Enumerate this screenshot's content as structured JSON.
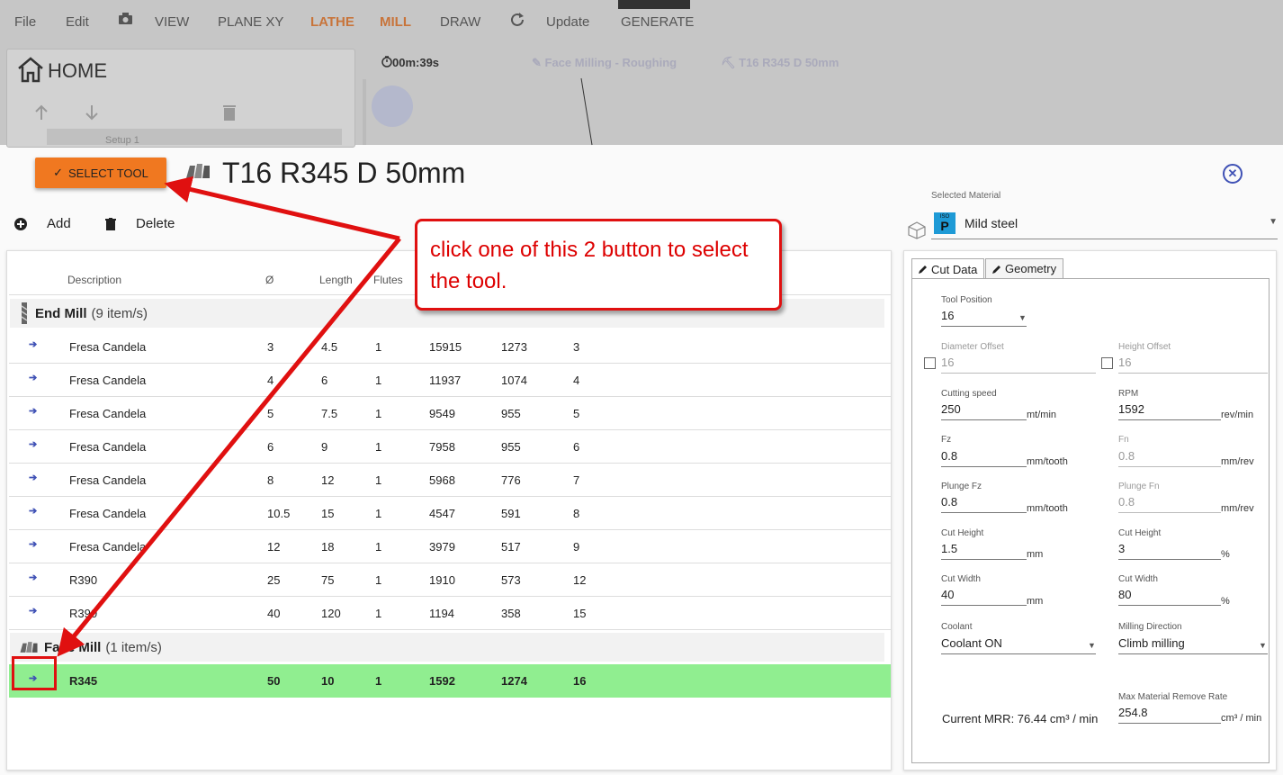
{
  "menubar": {
    "file": "File",
    "edit": "Edit",
    "view": "VIEW",
    "plane": "PLANE XY",
    "lathe": "LATHE",
    "mill": "MILL",
    "draw": "DRAW",
    "update": "Update",
    "generate": "GENERATE"
  },
  "background": {
    "home_title": "HOME",
    "setup_label": "Setup 1",
    "timer": "00m:39s",
    "operation": "Face Milling - Roughing",
    "tool_ref": "T16 R345 D 50mm"
  },
  "header": {
    "select_tool_label": "SELECT TOOL",
    "tool_title": "T16 R345 D 50mm",
    "add_label": "Add",
    "delete_label": "Delete"
  },
  "material": {
    "label": "Selected Material",
    "iso_top": "ISO",
    "iso_letter": "P",
    "name": "Mild steel"
  },
  "callout": {
    "text": "click one of this 2 button to select the tool."
  },
  "table": {
    "columns": [
      "Description",
      "Ø",
      "Length",
      "Flutes"
    ],
    "groups": [
      {
        "name": "End Mill",
        "count": "(9 item/s)",
        "rows": [
          [
            "Fresa Candela",
            "3",
            "4.5",
            "1",
            "15915",
            "1273",
            "3"
          ],
          [
            "Fresa Candela",
            "4",
            "6",
            "1",
            "11937",
            "1074",
            "4"
          ],
          [
            "Fresa Candela",
            "5",
            "7.5",
            "1",
            "9549",
            "955",
            "5"
          ],
          [
            "Fresa Candela",
            "6",
            "9",
            "1",
            "7958",
            "955",
            "6"
          ],
          [
            "Fresa Candela",
            "8",
            "12",
            "1",
            "5968",
            "776",
            "7"
          ],
          [
            "Fresa Candela",
            "10.5",
            "15",
            "1",
            "4547",
            "591",
            "8"
          ],
          [
            "Fresa Candela",
            "12",
            "18",
            "1",
            "3979",
            "517",
            "9"
          ],
          [
            "R390",
            "25",
            "75",
            "1",
            "1910",
            "573",
            "12"
          ],
          [
            "R390",
            "40",
            "120",
            "1",
            "1194",
            "358",
            "15"
          ]
        ]
      },
      {
        "name": "Face Mill",
        "count": "(1 item/s)",
        "rows": [
          [
            "R345",
            "50",
            "10",
            "1",
            "1592",
            "1274",
            "16"
          ]
        ]
      }
    ]
  },
  "cutdata": {
    "tab_cut": "Cut Data",
    "tab_geometry": "Geometry",
    "tool_position_label": "Tool Position",
    "tool_position": "16",
    "diameter_offset_label": "Diameter Offset",
    "diameter_offset": "16",
    "height_offset_label": "Height Offset",
    "height_offset": "16",
    "cutting_speed_label": "Cutting speed",
    "cutting_speed": "250",
    "cutting_speed_unit": "mt/min",
    "rpm_label": "RPM",
    "rpm": "1592",
    "rpm_unit": "rev/min",
    "fz_label": "Fz",
    "fz": "0.8",
    "fz_unit": "mm/tooth",
    "fn_label": "Fn",
    "fn": "0.8",
    "fn_unit": "mm/rev",
    "plunge_fz_label": "Plunge Fz",
    "plunge_fz": "0.8",
    "plunge_fz_unit": "mm/tooth",
    "plunge_fn_label": "Plunge Fn",
    "plunge_fn": "0.8",
    "plunge_fn_unit": "mm/rev",
    "cut_height_label": "Cut Height",
    "cut_height_mm": "1.5",
    "cut_height_mm_unit": "mm",
    "cut_height_pct": "3",
    "cut_height_pct_unit": "%",
    "cut_width_label": "Cut Width",
    "cut_width_mm": "40",
    "cut_width_mm_unit": "mm",
    "cut_width_pct": "80",
    "cut_width_pct_unit": "%",
    "coolant_label": "Coolant",
    "coolant": "Coolant ON",
    "milling_direction_label": "Milling Direction",
    "milling_direction": "Climb milling",
    "current_mrr": "Current MRR: 76.44 cm³ / min",
    "max_mrr_label": "Max Material Remove Rate",
    "max_mrr": "254.8",
    "max_mrr_unit": "cm³ / min"
  }
}
